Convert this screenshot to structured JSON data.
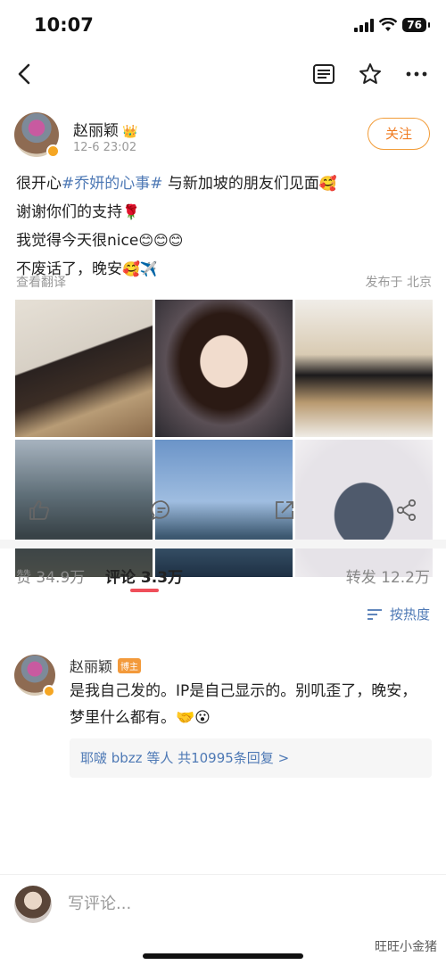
{
  "status_bar": {
    "time": "10:07",
    "battery": "76"
  },
  "nav": {
    "icons": [
      "back-icon",
      "reader-icon",
      "star-icon",
      "more-icon"
    ]
  },
  "post": {
    "author": "赵丽颖",
    "author_badge_icon": "crown-icon",
    "time": "12-6 23:02",
    "follow_label": "关注",
    "lines": [
      {
        "prefix": "很开心",
        "hashtag": "#乔妍的心事#",
        "suffix": " 与新加坡的朋友们见面",
        "emoji": "🥰"
      },
      {
        "text": "谢谢你们的支持",
        "emoji": "🌹"
      },
      {
        "text": "我觉得今天很nice",
        "emoji": "😊😊😊"
      },
      {
        "text": "不废话了，晚安",
        "emoji": "🥰✈️"
      }
    ],
    "translate_label": "查看翻译",
    "location_label": "发布于 北京",
    "photos": [
      "photo-1",
      "photo-2",
      "photo-3",
      "photo-4",
      "photo-5",
      "photo-6"
    ]
  },
  "stats": {
    "likes": "赞 34.9万",
    "comments": "评论 3.3万",
    "reposts": "转发 12.2万",
    "sort_label": "按热度"
  },
  "comment": {
    "author": "赵丽颖",
    "badge": "博主",
    "text": "是我自己发的。IP是自己显示的。别叽歪了，晚安，梦里什么都有。🤝😮",
    "replies": "耶啵 bbzz 等人 共10995条回复 >"
  },
  "bottom": {
    "placeholder": "写评论...",
    "watermark": "旺旺小金猪"
  },
  "colors": {
    "accent": "#f07c22",
    "link": "#4e79b5",
    "tab_underline": "#ef4f5a"
  }
}
